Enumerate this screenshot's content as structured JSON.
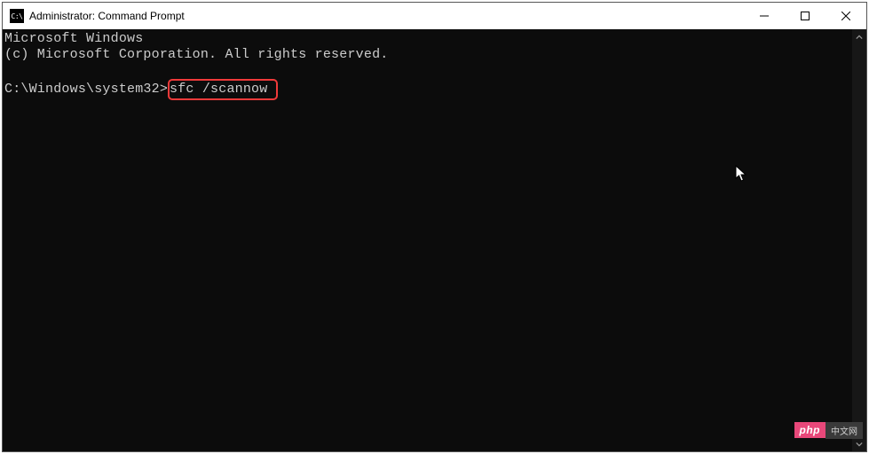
{
  "titlebar": {
    "icon_label": "C:\\",
    "title": "Administrator: Command Prompt"
  },
  "terminal": {
    "line1": "Microsoft Windows",
    "line2": "(c) Microsoft Corporation. All rights reserved.",
    "prompt": "C:\\Windows\\system32>",
    "command": "sfc /scannow"
  },
  "watermark": {
    "left": "php",
    "right": "中文网"
  }
}
